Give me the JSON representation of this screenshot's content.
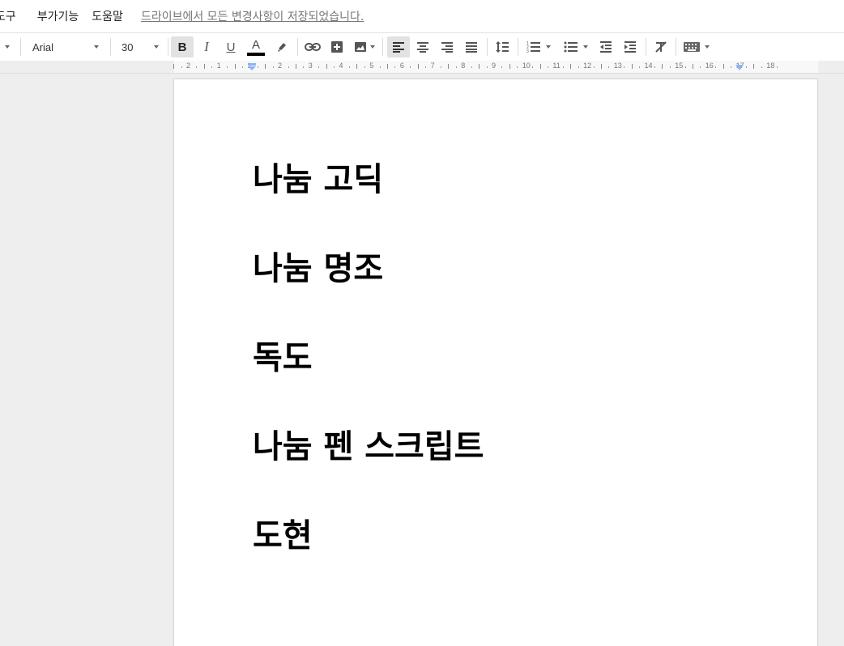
{
  "menu": {
    "items": [
      "도구",
      "부가기능",
      "도움말"
    ],
    "save_status": "드라이브에서 모든 변경사항이 저장되었습니다."
  },
  "toolbar": {
    "font_name": "Arial",
    "font_size": "30",
    "bold_label": "B",
    "italic_label": "I",
    "underline_label": "U",
    "text_color_label": "A",
    "bold_active": true,
    "align_left_active": true
  },
  "ruler": {
    "labels": [
      "2",
      "1",
      "1",
      "2",
      "3",
      "4",
      "5",
      "6",
      "7",
      "8",
      "9",
      "10",
      "11",
      "12",
      "13",
      "14",
      "15",
      "16",
      "17",
      "18"
    ]
  },
  "document": {
    "lines": [
      "나눔 고딕",
      "나눔 명조",
      "독도",
      "나눔 펜 스크립트",
      "도현"
    ]
  },
  "colors": {
    "text_color_bar": "#000000",
    "indent_marker": "#8ab4f8"
  }
}
